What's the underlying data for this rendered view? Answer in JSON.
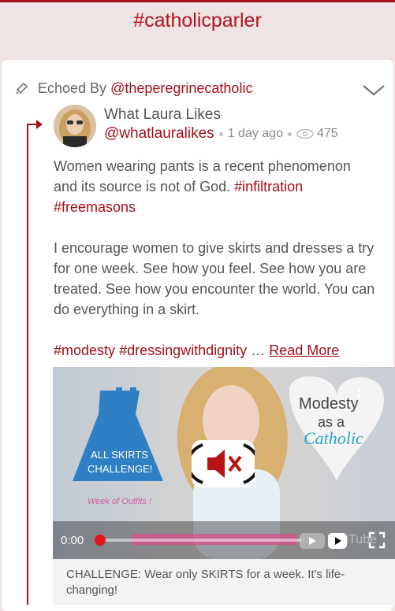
{
  "header": {
    "title": "#catholicparler"
  },
  "echo": {
    "prefix": "Echoed By",
    "handle": "@theperegrinecatholic"
  },
  "post": {
    "author_name": "What Laura Likes",
    "author_handle": "@whatlauralikes",
    "age": "1 day ago",
    "views": "475",
    "p1_text": "Women wearing pants is a recent phenomenon and its source is not of God. ",
    "p1_tag1": "#infiltration",
    "p1_tag2": "#freemasons",
    "p2": "I encourage women to give skirts and dresses a try for one week. See how you feel. See how you are treated. See how you encounter the world. You can do everything in a skirt.",
    "tag3": "#modesty",
    "tag4": "#dressingwithdignity",
    "ellipsis": " …",
    "read_more": "Read More"
  },
  "video": {
    "dress_label_1": "ALL SKIRTS",
    "dress_label_2": "CHALLENGE!",
    "week_label": "Week of Outfits !",
    "heart_text_1": "Modesty",
    "heart_text_2": "as a",
    "heart_text_3": "Catholic",
    "time": "0:00",
    "youtube_label": "YouTube",
    "caption": "CHALLENGE: Wear only SKIRTS for a week. It's life-changing!"
  },
  "colors": {
    "accent": "#a3101a",
    "background": "#efe3e3"
  }
}
